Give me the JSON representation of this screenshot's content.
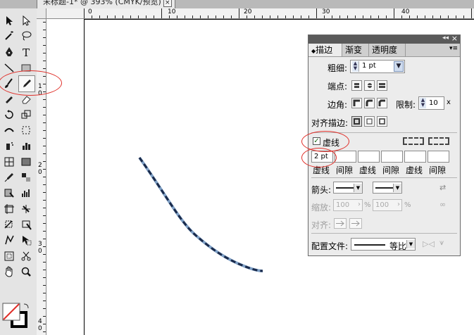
{
  "document": {
    "tab_title": "未标题-1* @ 393% (CMYK/预览)",
    "close_glyph": "×"
  },
  "rulers": {
    "horizontal_labels": [
      "0",
      "10",
      "20",
      "30",
      "40"
    ],
    "vertical_labels": [
      "1",
      "0",
      "2",
      "0",
      "3",
      "0",
      "4",
      "0"
    ]
  },
  "toolbar": {
    "tools": [
      "selection-icon",
      "direct-selection-icon",
      "magic-wand-icon",
      "lasso-icon",
      "pen-icon",
      "type-icon",
      "line-icon",
      "rectangle-icon",
      "paintbrush-icon",
      "pencil-icon",
      "blob-brush-icon",
      "eraser-icon",
      "rotate-icon",
      "scale-icon",
      "warp-icon",
      "free-transform-icon",
      "symbol-sprayer-icon",
      "column-graph-icon",
      "mesh-icon",
      "gradient-icon",
      "eyedropper-icon",
      "blend-icon",
      "live-paint-icon",
      "bar-graph-icon",
      "artboard-icon",
      "slice-icon",
      "crop-icon",
      "perspective-icon",
      "shape-builder-icon",
      "live-paint-select-icon",
      "print-tiling-icon",
      "scissors-icon",
      "hand-icon",
      "zoom-icon"
    ],
    "highlight_color": "#e0302a"
  },
  "panel": {
    "collapse_glyph": "◂◂",
    "close_glyph": "×",
    "menu_glyph": "▾≡",
    "tabs": [
      {
        "label": "描边",
        "prefix": "◆"
      },
      {
        "label": "渐变"
      },
      {
        "label": "透明度"
      }
    ],
    "weight_label": "粗细:",
    "weight_value": "1 pt",
    "cap_label": "端点:",
    "corner_label": "边角:",
    "limit_label": "限制:",
    "limit_value": "10",
    "limit_suffix": "x",
    "align_label": "对齐描边:",
    "dashed_label": "虚线",
    "dashed_checked": true,
    "dash_fields": [
      {
        "value": "2 pt",
        "label": "虚线"
      },
      {
        "value": "",
        "label": "间隙"
      },
      {
        "value": "",
        "label": "虚线"
      },
      {
        "value": "",
        "label": "间隙"
      },
      {
        "value": "",
        "label": "虚线"
      },
      {
        "value": "",
        "label": "间隙"
      }
    ],
    "arrow_label": "箭头:",
    "scale_label": "缩放:",
    "scale_start": "100",
    "scale_end": "100",
    "percent": "%",
    "align2_label": "对齐:",
    "profile_label": "配置文件:",
    "profile_value": "等比"
  },
  "canvas": {
    "path_color": "#1a2a4a",
    "highlight_color": "#e0302a"
  }
}
